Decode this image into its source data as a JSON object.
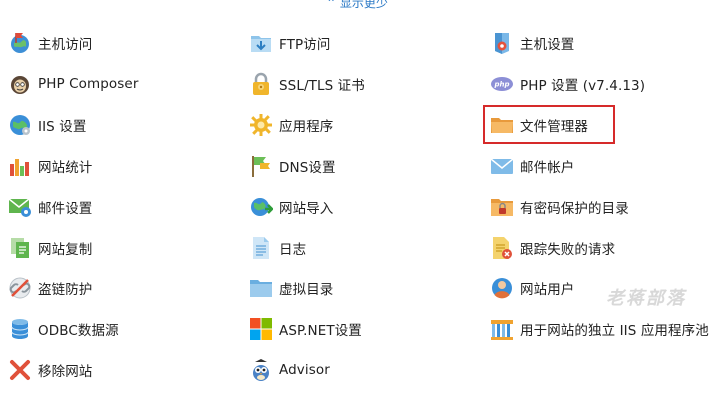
{
  "header": {
    "show_less_label": "⌃ 显示更少"
  },
  "items": [
    {
      "label": "主机访问",
      "icon": "host-access-icon"
    },
    {
      "label": "FTP访问",
      "icon": "ftp-access-icon"
    },
    {
      "label": "主机设置",
      "icon": "host-settings-icon"
    },
    {
      "label": "PHP Composer",
      "icon": "php-composer-icon"
    },
    {
      "label": "SSL/TLS 证书",
      "icon": "ssl-lock-icon"
    },
    {
      "label": "PHP 设置 (v7.4.13)",
      "icon": "php-settings-icon"
    },
    {
      "label": "IIS 设置",
      "icon": "iis-settings-icon"
    },
    {
      "label": "应用程序",
      "icon": "applications-gear-icon"
    },
    {
      "label": "文件管理器",
      "icon": "file-manager-folder-icon"
    },
    {
      "label": "网站统计",
      "icon": "web-statistics-icon"
    },
    {
      "label": "DNS设置",
      "icon": "dns-settings-icon"
    },
    {
      "label": "邮件帐户",
      "icon": "mail-accounts-icon"
    },
    {
      "label": "邮件设置",
      "icon": "mail-settings-icon"
    },
    {
      "label": "网站导入",
      "icon": "website-import-icon"
    },
    {
      "label": "有密码保护的目录",
      "icon": "password-protected-dir-icon"
    },
    {
      "label": "网站复制",
      "icon": "website-copy-icon"
    },
    {
      "label": "日志",
      "icon": "logs-icon"
    },
    {
      "label": "跟踪失败的请求",
      "icon": "failed-requests-icon"
    },
    {
      "label": "盗链防护",
      "icon": "hotlink-protection-icon"
    },
    {
      "label": "虚拟目录",
      "icon": "virtual-directory-icon"
    },
    {
      "label": "网站用户",
      "icon": "web-users-icon"
    },
    {
      "label": "ODBC数据源",
      "icon": "odbc-datasource-icon"
    },
    {
      "label": "ASP.NET设置",
      "icon": "aspnet-settings-icon"
    },
    {
      "label": "用于网站的独立 IIS 应用程序池",
      "icon": "iis-app-pool-icon"
    },
    {
      "label": "移除网站",
      "icon": "remove-website-icon"
    },
    {
      "label": "Advisor",
      "icon": "advisor-owl-icon"
    }
  ],
  "highlight": {
    "item": "文件管理器",
    "color": "#d62a2a"
  },
  "watermark": "老蒋部落",
  "colors": {
    "link": "#2a78c5",
    "text": "#222222",
    "highlight": "#d62a2a"
  }
}
